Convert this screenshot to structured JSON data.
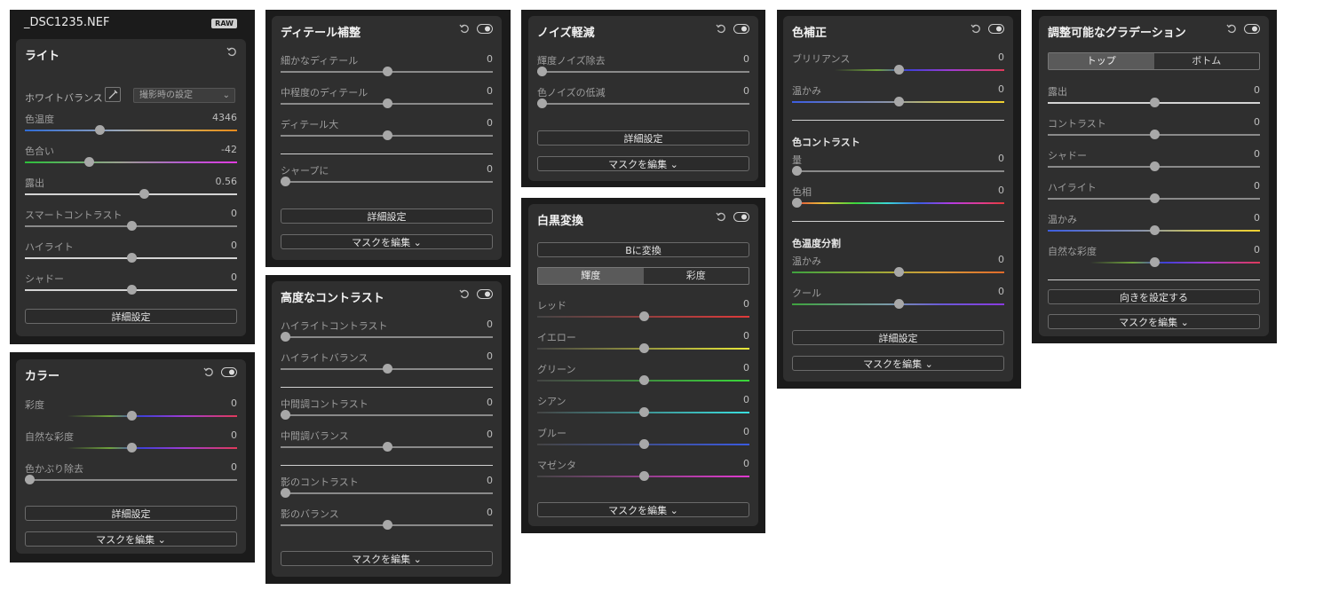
{
  "gradients": {
    "temp": "linear-gradient(to right,#2e6bd6,#9aa7b8 45%,#d8a94a 75%,#e68a1c)",
    "tint": "linear-gradient(to right,#2bbf3a,#9aa090 45%,#b65ad3 75%,#e23be0)",
    "hue": "linear-gradient(to right,#e23b3b,#e8c53a 15%,#3bd63b 30%,#3bd6d6 45%,#3b5de2 60%,#b43be2 75%,#e23b8a 90%,#e23b3b)",
    "vib": "linear-gradient(to right,#2f2f2f 20%,#6fa33b 40%,#4040d8 55%,#a03bd0 75%,#e03a5a)",
    "warm": "linear-gradient(to right,#3c5de0,#8a93a8 45%,#c9c25a 70%,#f0d030)",
    "split": "linear-gradient(to right,#3ea23e,#a8a838 45%,#d89a38 70%,#e06a2a)",
    "cool": "linear-gradient(to right,#3ea23e,#7a9aa8 45%,#6a5ad8 70%,#8a3ae0)",
    "white": "#d4d4d4",
    "red": "linear-gradient(to right,#444,#e03a3a)",
    "yellow": "linear-gradient(to right,#444,#e8e83a)",
    "green": "linear-gradient(to right,#444,#3ad83a)",
    "cyan": "linear-gradient(to right,#444,#3ae0e0)",
    "blue": "linear-gradient(to right,#444,#3a5ae0)",
    "magenta": "linear-gradient(to right,#444,#e03ad0)"
  },
  "light": {
    "file_title": "_DSC1235.NEF",
    "raw_badge": "RAW",
    "title": "ライト",
    "wb_label": "ホワイトバランス",
    "wb_value": "撮影時の設定",
    "btn_details": "詳細設定",
    "sliders": [
      {
        "label": "色温度",
        "value": "4346",
        "pos": 0.35,
        "grad": "temp"
      },
      {
        "label": "色合い",
        "value": "-42",
        "pos": 0.3,
        "grad": "tint"
      },
      {
        "label": "露出",
        "value": "0.56",
        "pos": 0.56,
        "grad": "white"
      },
      {
        "label": "スマートコントラスト",
        "value": "0",
        "pos": 0.5
      },
      {
        "label": "ハイライト",
        "value": "0",
        "pos": 0.5,
        "grad": "white"
      },
      {
        "label": "シャドー",
        "value": "0",
        "pos": 0.5,
        "grad": "white"
      }
    ]
  },
  "color": {
    "title": "カラー",
    "btn_details": "詳細設定",
    "btn_mask": "マスクを編集 ⌄",
    "sliders": [
      {
        "label": "彩度",
        "value": "0",
        "pos": 0.5,
        "grad": "vib"
      },
      {
        "label": "自然な彩度",
        "value": "0",
        "pos": 0.5,
        "grad": "vib"
      },
      {
        "label": "色かぶり除去",
        "value": "0",
        "pos": 0.02
      }
    ]
  },
  "detail": {
    "title": "ディテール補整",
    "btn_details": "詳細設定",
    "btn_mask": "マスクを編集 ⌄",
    "sliders": [
      {
        "label": "細かなディテール",
        "value": "0",
        "pos": 0.5
      },
      {
        "label": "中程度のディテール",
        "value": "0",
        "pos": 0.5
      },
      {
        "label": "ディテール大",
        "value": "0",
        "pos": 0.5
      },
      {
        "label": "シャープに",
        "value": "0",
        "pos": 0.02
      }
    ]
  },
  "contrast": {
    "title": "高度なコントラスト",
    "btn_mask": "マスクを編集 ⌄",
    "sliders": [
      {
        "label": "ハイライトコントラスト",
        "value": "0",
        "pos": 0.02
      },
      {
        "label": "ハイライトバランス",
        "value": "0",
        "pos": 0.5
      },
      {
        "label": "中間調コントラスト",
        "value": "0",
        "pos": 0.02
      },
      {
        "label": "中間調バランス",
        "value": "0",
        "pos": 0.5
      },
      {
        "label": "影のコントラスト",
        "value": "0",
        "pos": 0.02
      },
      {
        "label": "影のバランス",
        "value": "0",
        "pos": 0.5
      }
    ]
  },
  "noise": {
    "title": "ノイズ軽減",
    "btn_details": "詳細設定",
    "btn_mask": "マスクを編集 ⌄",
    "sliders": [
      {
        "label": "輝度ノイズ除去",
        "value": "0",
        "pos": 0.02
      },
      {
        "label": "色ノイズの低減",
        "value": "0",
        "pos": 0.02
      }
    ]
  },
  "bw": {
    "title": "白黒変換",
    "btn_convert": "Bに変換",
    "seg_luma": "輝度",
    "seg_sat": "彩度",
    "btn_mask": "マスクを編集 ⌄",
    "sliders": [
      {
        "label": "レッド",
        "value": "0",
        "pos": 0.5,
        "grad": "red"
      },
      {
        "label": "イエロー",
        "value": "0",
        "pos": 0.5,
        "grad": "yellow"
      },
      {
        "label": "グリーン",
        "value": "0",
        "pos": 0.5,
        "grad": "green"
      },
      {
        "label": "シアン",
        "value": "0",
        "pos": 0.5,
        "grad": "cyan"
      },
      {
        "label": "ブルー",
        "value": "0",
        "pos": 0.5,
        "grad": "blue"
      },
      {
        "label": "マゼンタ",
        "value": "0",
        "pos": 0.5,
        "grad": "magenta"
      }
    ]
  },
  "colorcorr": {
    "title": "色補正",
    "sub_contrast": "色コントラスト",
    "sub_split": "色温度分割",
    "btn_details": "詳細設定",
    "btn_mask": "マスクを編集 ⌄",
    "sliders": [
      {
        "label": "ブリリアンス",
        "value": "0",
        "pos": 0.5,
        "grad": "vib"
      },
      {
        "label": "温かみ",
        "value": "0",
        "pos": 0.5,
        "grad": "warm"
      },
      {
        "label": "量",
        "value": "0",
        "pos": 0.02
      },
      {
        "label": "色相",
        "value": "0",
        "pos": 0.02,
        "grad": "hue"
      },
      {
        "label": "温かみ",
        "value": "0",
        "pos": 0.5,
        "grad": "split"
      },
      {
        "label": "クール",
        "value": "0",
        "pos": 0.5,
        "grad": "cool"
      }
    ]
  },
  "gradient": {
    "title": "調整可能なグラデーション",
    "tab_top": "トップ",
    "tab_bottom": "ボトム",
    "btn_orient": "向きを設定する",
    "btn_mask": "マスクを編集 ⌄",
    "sliders": [
      {
        "label": "露出",
        "value": "0",
        "pos": 0.5,
        "grad": "white"
      },
      {
        "label": "コントラスト",
        "value": "0",
        "pos": 0.5
      },
      {
        "label": "シャドー",
        "value": "0",
        "pos": 0.5
      },
      {
        "label": "ハイライト",
        "value": "0",
        "pos": 0.5
      },
      {
        "label": "温かみ",
        "value": "0",
        "pos": 0.5,
        "grad": "warm"
      },
      {
        "label": "自然な彩度",
        "value": "0",
        "pos": 0.5,
        "grad": "vib"
      }
    ]
  }
}
